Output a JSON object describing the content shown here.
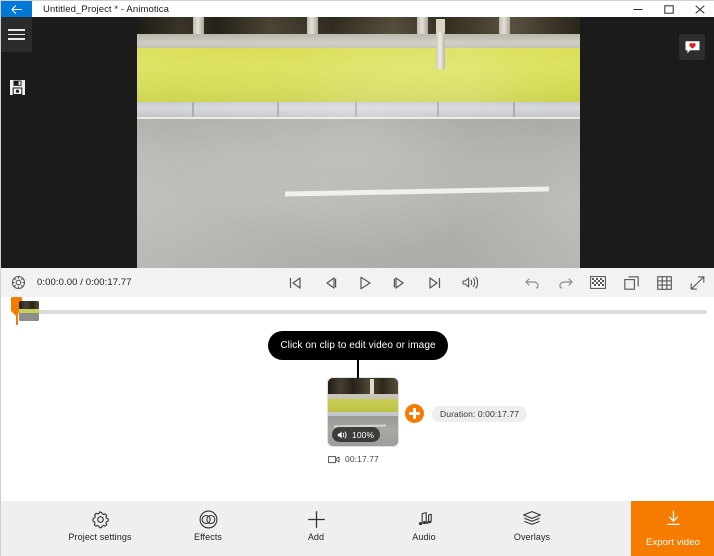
{
  "titlebar": {
    "back_icon": "back-arrow-icon",
    "title": "Untitled_Project * - Animotica",
    "minimize_label": "minimize-icon",
    "maximize_label": "maximize-icon",
    "close_label": "close-icon"
  },
  "left_rail": {
    "menu_icon": "hamburger-menu-icon",
    "save_icon": "save-icon"
  },
  "right_rail": {
    "feedback_icon": "feedback-heart-icon"
  },
  "transport": {
    "settings_icon": "preview-settings-icon",
    "timecode": "0:00:0.00 / 0:00:17.77",
    "current_time": "0:00:0.00",
    "total_time": "0:00:17.77",
    "controls": [
      {
        "name": "skip-to-start-button",
        "icon": "skip-start-icon"
      },
      {
        "name": "step-backward-button",
        "icon": "step-back-icon"
      },
      {
        "name": "play-button",
        "icon": "play-icon"
      },
      {
        "name": "step-forward-button",
        "icon": "step-forward-icon"
      },
      {
        "name": "skip-to-end-button",
        "icon": "skip-end-icon"
      },
      {
        "name": "volume-button",
        "icon": "volume-icon"
      }
    ],
    "right_controls": [
      {
        "name": "undo-button",
        "icon": "undo-icon"
      },
      {
        "name": "redo-button",
        "icon": "redo-icon"
      },
      {
        "name": "transparency-button",
        "icon": "checkerboard-icon"
      },
      {
        "name": "duplicate-button",
        "icon": "copy-icon"
      },
      {
        "name": "grid-button",
        "icon": "grid-icon"
      },
      {
        "name": "fullscreen-button",
        "icon": "expand-icon"
      }
    ]
  },
  "timeline": {
    "tooltip": "Click on clip to edit video or image",
    "clip": {
      "volume_label": "100%",
      "volume_icon": "speaker-icon",
      "length_label": "00:17.77",
      "length_icon": "video-camera-icon"
    },
    "add_clip_icon": "plus-icon",
    "duration_badge": "Duration: 0:00:17.77"
  },
  "bottombar": {
    "tools": [
      {
        "icon": "gear-icon",
        "label": "Project settings"
      },
      {
        "icon": "effects-icon",
        "label": "Effects"
      },
      {
        "icon": "plus-icon",
        "label": "Add"
      },
      {
        "icon": "music-note-icon",
        "label": "Audio"
      },
      {
        "icon": "layers-icon",
        "label": "Overlays"
      }
    ],
    "export": {
      "icon": "download-icon",
      "label": "Export video"
    }
  },
  "colors": {
    "accent_orange": "#f57c00",
    "titlebar_blue": "#0078d7",
    "panel_dark": "#1b1b1b",
    "toolbar_gray": "#efefef"
  }
}
